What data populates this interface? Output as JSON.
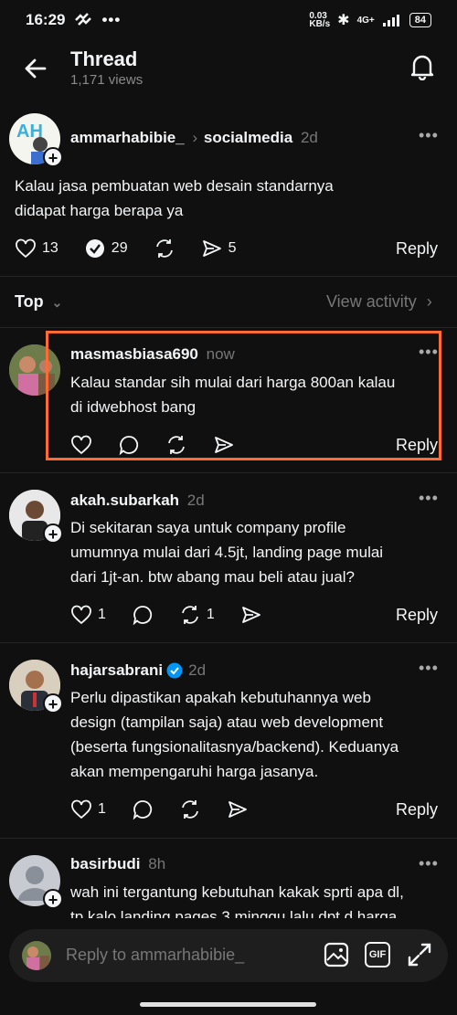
{
  "status": {
    "time": "16:29",
    "speed": "0.03",
    "speed_unit": "KB/s",
    "network": "4G+",
    "battery": "84"
  },
  "header": {
    "title": "Thread",
    "views": "1,171 views"
  },
  "original": {
    "username": "ammarhabibie_",
    "arrow": "›",
    "community": "socialmedia",
    "time": "2d",
    "text_line1": "Kalau jasa pembuatan web desain standarnya",
    "text_line2": "didapat harga berapa ya",
    "likes": "13",
    "comments": "29",
    "shares": "5",
    "reply": "Reply"
  },
  "sort": {
    "label": "Top",
    "activity": "View activity"
  },
  "replies": [
    {
      "username": "masmasbiasa690",
      "time": "now",
      "line1": "Kalau standar sih mulai dari harga 800an kalau",
      "line2": "di idwebhost bang",
      "reply": "Reply"
    },
    {
      "username": "akah.subarkah",
      "time": "2d",
      "line1": "Di sekitaran saya untuk company profile",
      "line2": "umumnya mulai dari 4.5jt, landing page mulai",
      "line3": "dari 1jt-an. btw abang mau beli atau jual?",
      "likes": "1",
      "reposts": "1",
      "reply": "Reply"
    },
    {
      "username": "hajarsabrani",
      "time": "2d",
      "line1": "Perlu dipastikan apakah kebutuhannya web",
      "line2": "design (tampilan saja) atau web development",
      "line3": "(beserta fungsionalitasnya/backend). Keduanya",
      "line4": "akan mempengaruhi harga jasanya.",
      "likes": "1",
      "reply": "Reply"
    },
    {
      "username": "basirbudi",
      "time": "8h",
      "line1": "wah ini tergantung kebutuhan kakak sprti apa dl,",
      "line2": "tp kalo landing pages 3 minggu lalu dpt d harga"
    }
  ],
  "composer": {
    "placeholder": "Reply to ammarhabibie_",
    "gif": "GIF"
  },
  "colors": {
    "background": "#101010",
    "highlight": "#ff6b35",
    "verified": "#0095f6"
  }
}
